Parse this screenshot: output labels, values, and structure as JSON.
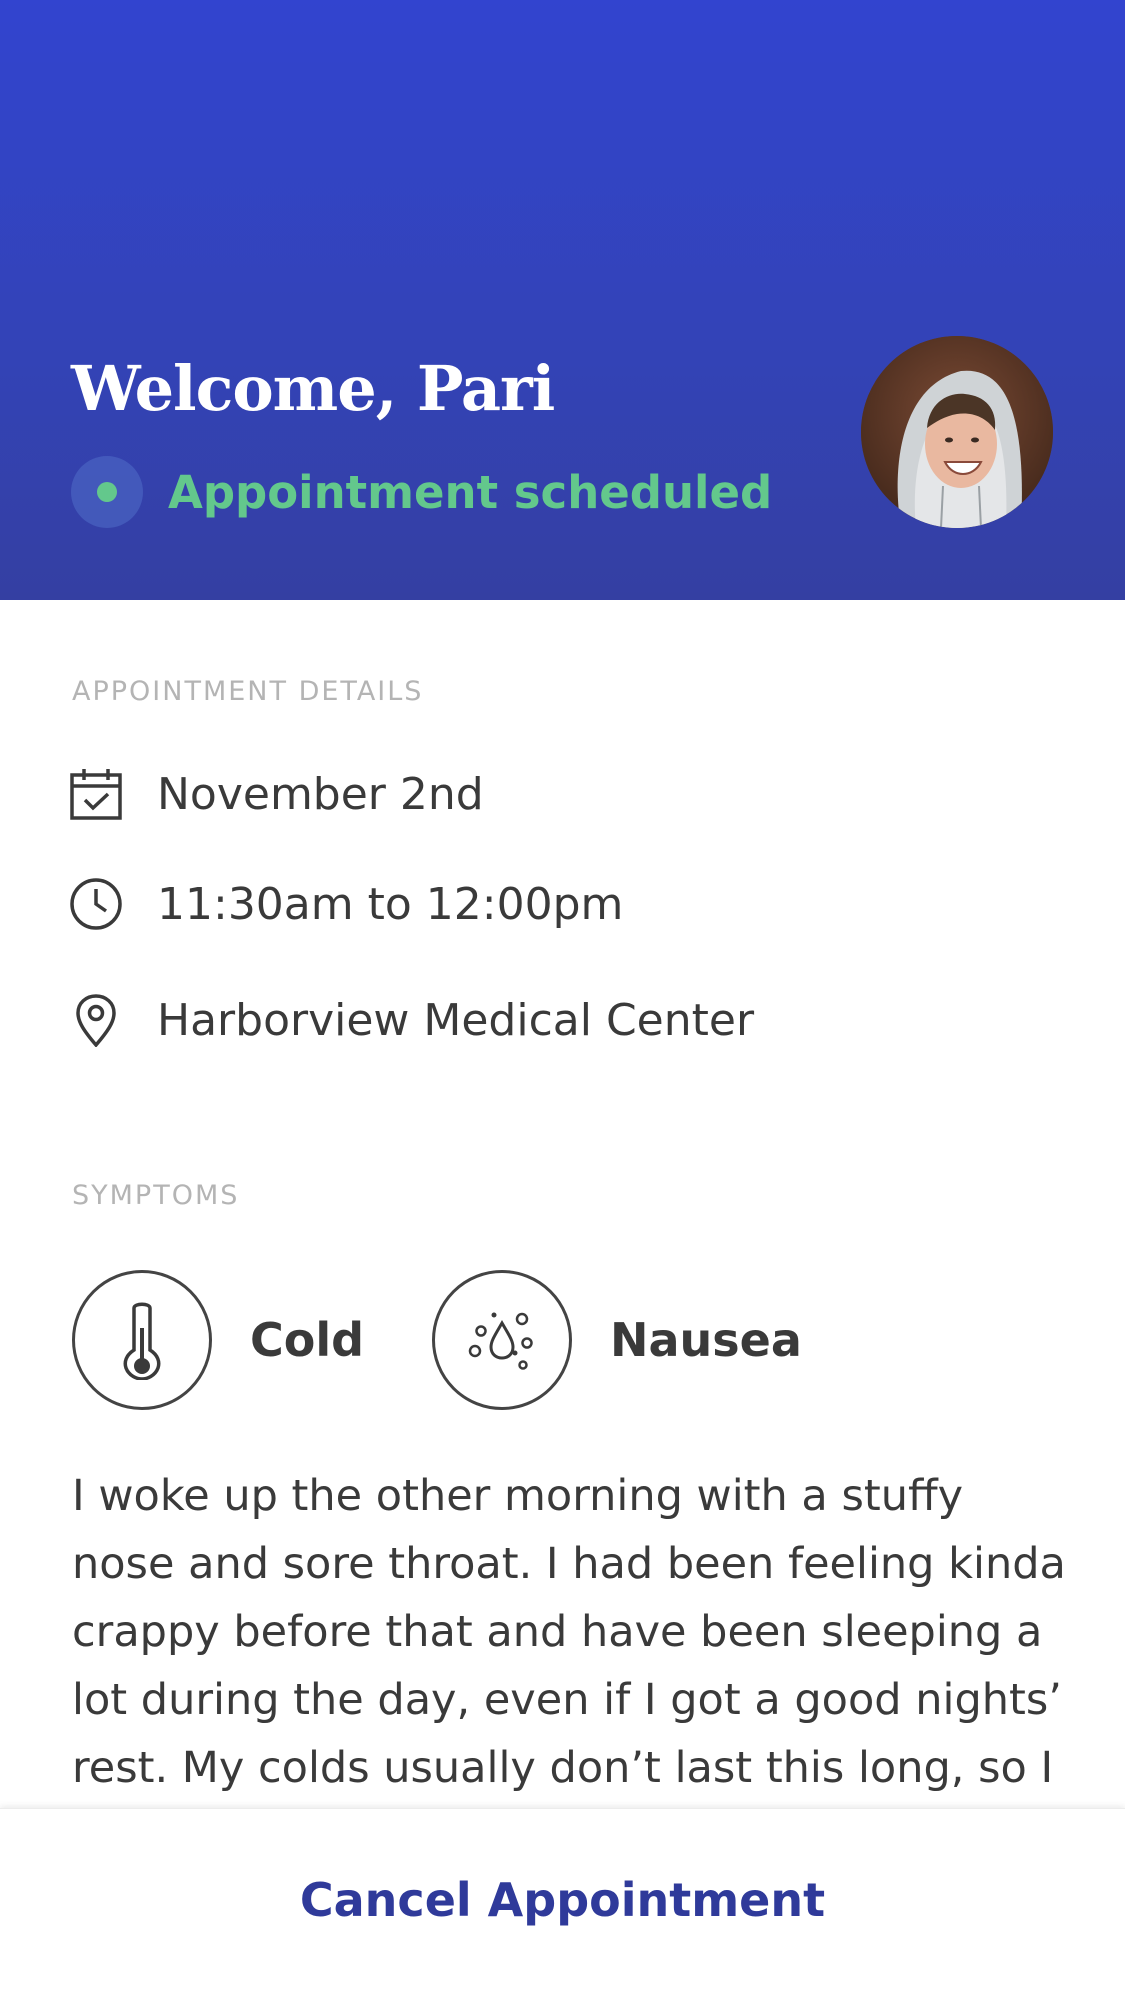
{
  "header": {
    "welcome_text": "Welcome, Pari",
    "status_text": "Appointment scheduled",
    "status_color": "#63c88c",
    "gradient_top": "#3244cf",
    "gradient_bottom": "#343fa2"
  },
  "details": {
    "section_label": "APPOINTMENT DETAILS",
    "date": {
      "icon": "calendar-check-icon",
      "text": "November 2nd"
    },
    "time": {
      "icon": "clock-icon",
      "text": "11:30am to 12:00pm"
    },
    "location": {
      "icon": "map-pin-icon",
      "text": "Harborview Medical Center"
    }
  },
  "symptoms": {
    "section_label": "SYMPTOMS",
    "items": [
      {
        "icon": "thermometer-icon",
        "label": "Cold"
      },
      {
        "icon": "droplets-icon",
        "label": "Nausea"
      }
    ],
    "description": "I woke up the other morning with a stuffy nose and sore throat. I had been feeling kinda crappy before that and have been sleeping a lot during the day, even if I got a good nights’ rest. My colds usually don’t last this long, so I"
  },
  "footer": {
    "cancel_label": "Cancel Appointment",
    "cancel_color": "#2f3a9a"
  }
}
